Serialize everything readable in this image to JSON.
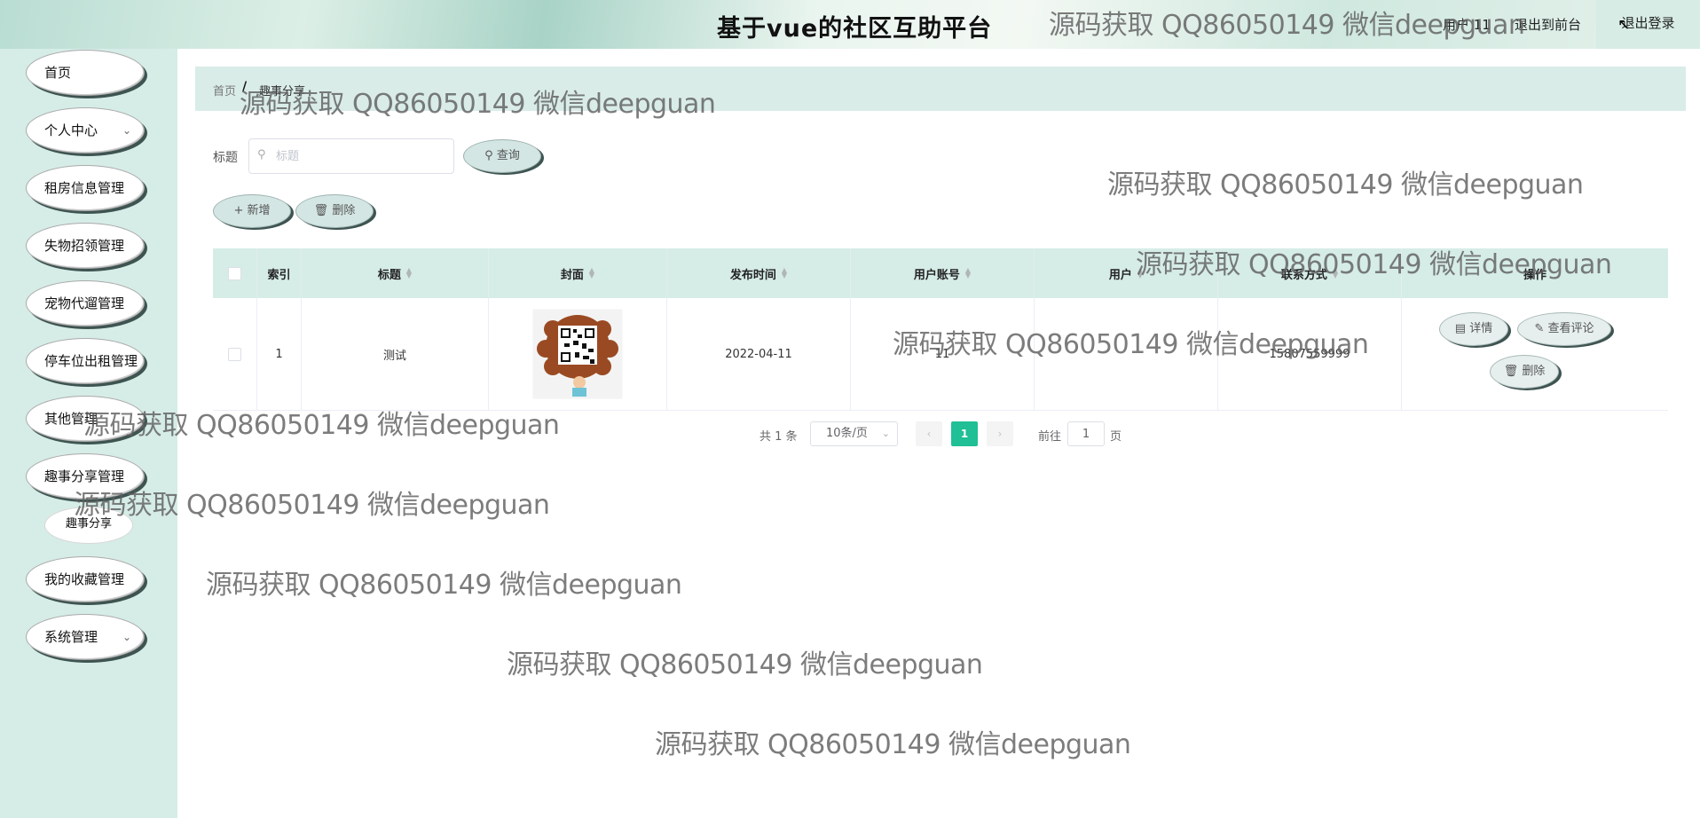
{
  "header": {
    "title": "基于vue的社区互助平台",
    "user": "用户 11",
    "front": "退出到前台",
    "logout": "退出登录"
  },
  "sidebar": {
    "items": [
      {
        "label": "首页"
      },
      {
        "label": "个人中心"
      },
      {
        "label": "租房信息管理"
      },
      {
        "label": "失物招领管理"
      },
      {
        "label": "宠物代遛管理"
      },
      {
        "label": "停车位出租管理"
      },
      {
        "label": "其他管理"
      },
      {
        "label": "趣事分享管理"
      },
      {
        "label": "我的收藏管理"
      },
      {
        "label": "系统管理"
      }
    ],
    "sub_item": "趣事分享"
  },
  "breadcrumb": {
    "home": "首页",
    "sep": "/",
    "current": "趣事分享"
  },
  "search": {
    "label": "标题",
    "placeholder": "标题",
    "button": "查询"
  },
  "actions": {
    "add": "新增",
    "delete": "删除"
  },
  "table": {
    "columns": [
      "索引",
      "标题",
      "封面",
      "发布时间",
      "用户账号",
      "用户",
      "联系方式",
      "操作"
    ],
    "rows": [
      {
        "index": "1",
        "title": "测试",
        "date": "2022-04-11",
        "account": "11",
        "user": "",
        "contact": "15807559999"
      }
    ],
    "ops": {
      "detail": "详情",
      "comments": "查看评论",
      "delete": "删除"
    }
  },
  "pagination": {
    "total": "共 1 条",
    "page_size": "10条/页",
    "prev": "‹",
    "current": "1",
    "next": "›",
    "goto": "前往",
    "goto_value": "1",
    "page_suffix": "页"
  },
  "watermark": "源码获取 QQ86050149 微信deepguan",
  "colors": {
    "accent": "#20bf95",
    "sidebar_bg": "#d6ece7",
    "table_head_bg": "#d6ece7",
    "shadow": "#3e5451"
  }
}
